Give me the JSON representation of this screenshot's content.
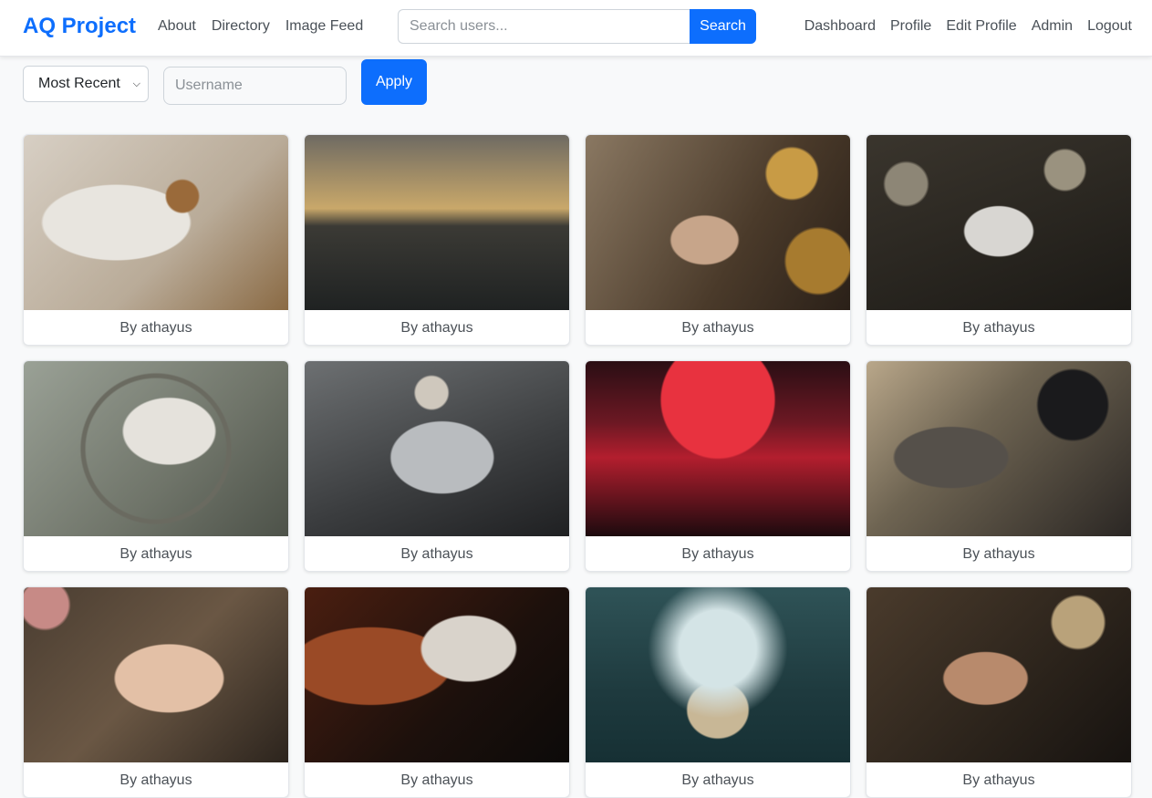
{
  "nav": {
    "brand": "AQ Project",
    "left_links": [
      "About",
      "Directory",
      "Image Feed"
    ],
    "search": {
      "placeholder": "Search users...",
      "value": "",
      "button_label": "Search"
    },
    "right_links": [
      "Dashboard",
      "Profile",
      "Edit Profile",
      "Admin",
      "Logout"
    ]
  },
  "filters": {
    "sort_selected": "Most Recent",
    "username_placeholder": "Username",
    "username_value": "",
    "apply_label": "Apply"
  },
  "gallery": {
    "cards": [
      {
        "caption": "By athayus"
      },
      {
        "caption": "By athayus"
      },
      {
        "caption": "By athayus"
      },
      {
        "caption": "By athayus"
      },
      {
        "caption": "By athayus"
      },
      {
        "caption": "By athayus"
      },
      {
        "caption": "By athayus"
      },
      {
        "caption": "By athayus"
      },
      {
        "caption": "By athayus"
      },
      {
        "caption": "By athayus"
      },
      {
        "caption": "By athayus"
      },
      {
        "caption": "By athayus"
      }
    ]
  },
  "colors": {
    "accent": "#0d6efd",
    "background": "#f8f9fa"
  }
}
